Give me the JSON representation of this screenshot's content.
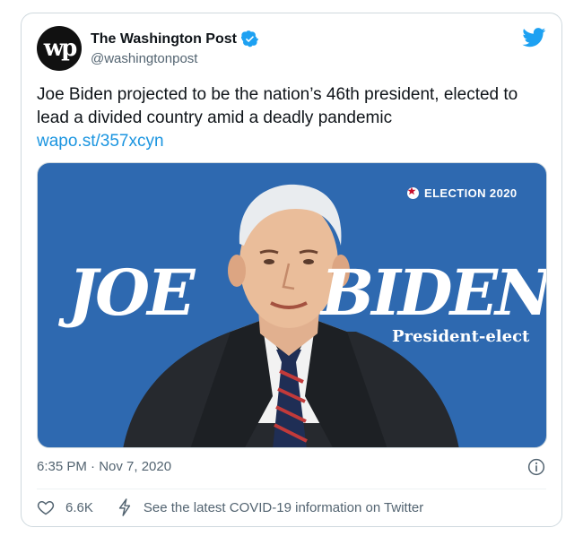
{
  "account": {
    "avatar_text": "wp",
    "name": "The Washington Post",
    "handle": "@washingtonpost",
    "verified": true
  },
  "tweet": {
    "text": "Joe Biden projected to be the nation’s 46th president, elected to lead a divided country amid a deadly pandemic",
    "link": "wapo.st/357xcyn"
  },
  "media": {
    "badge": "ELECTION 2020",
    "first_name": "JOE",
    "last_name": "BIDEN",
    "subtitle": "President-elect"
  },
  "timestamp": "6:35 PM · Nov 7, 2020",
  "actions": {
    "likes": "6.6K",
    "covid_text": "See the latest COVID-19 information on Twitter"
  },
  "colors": {
    "brand_blue": "#1da1f2",
    "link_blue": "#1b95e0",
    "media_bg": "#2e69b0",
    "muted": "#536471"
  },
  "icons": [
    "twitter-bird-icon",
    "verified-badge-icon",
    "info-icon",
    "heart-icon",
    "lightning-bolt-icon",
    "star-icon"
  ]
}
